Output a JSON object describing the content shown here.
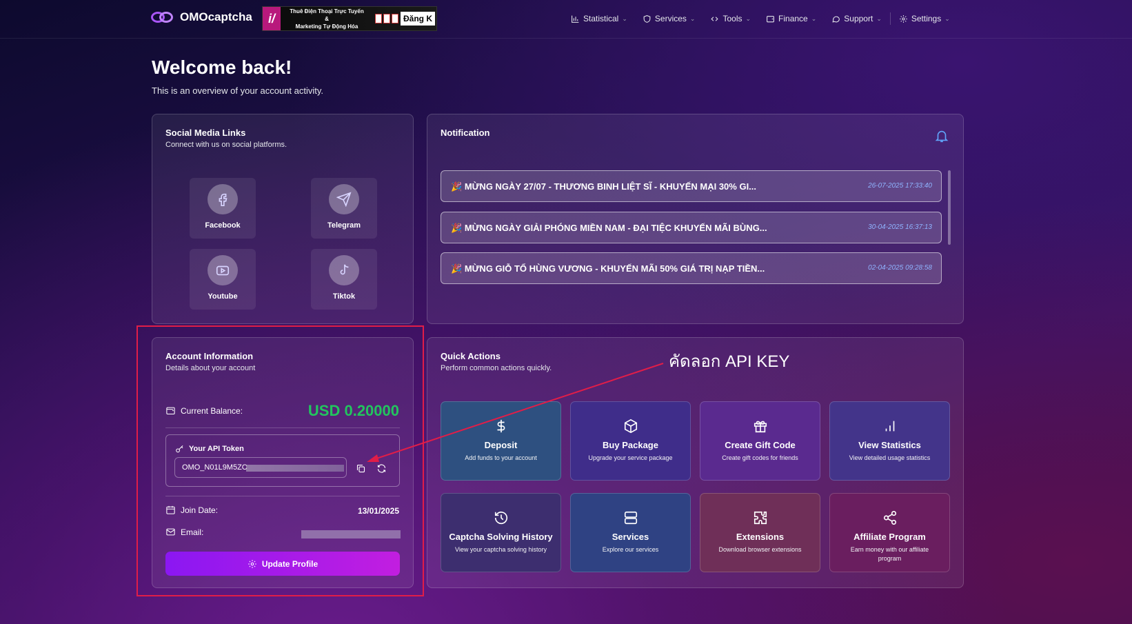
{
  "brand": {
    "name": "OMOcaptcha"
  },
  "banner": {
    "line1": "Thuê Điện Thoại Trực Tuyến",
    "line2": "&",
    "line3": "Marketing Tự Động Hóa",
    "cta": "Đăng K"
  },
  "nav": [
    {
      "label": "Statistical",
      "icon": "bar-chart-icon"
    },
    {
      "label": "Services",
      "icon": "shield-icon"
    },
    {
      "label": "Tools",
      "icon": "code-icon"
    },
    {
      "label": "Finance",
      "icon": "wallet-icon"
    },
    {
      "label": "Support",
      "icon": "chat-icon"
    },
    {
      "label": "Settings",
      "icon": "gear-icon"
    }
  ],
  "page": {
    "title": "Welcome back!",
    "subtitle": "This is an overview of your account activity."
  },
  "social": {
    "title": "Social Media Links",
    "subtitle": "Connect with us on social platforms.",
    "items": [
      {
        "label": "Facebook",
        "icon": "facebook-icon"
      },
      {
        "label": "Telegram",
        "icon": "telegram-icon"
      },
      {
        "label": "Youtube",
        "icon": "youtube-icon"
      },
      {
        "label": "Tiktok",
        "icon": "tiktok-icon"
      }
    ]
  },
  "notification": {
    "title": "Notification",
    "items": [
      {
        "emoji": "🎉",
        "text": "MỪNG NGÀY 27/07 - THƯƠNG BINH LIỆT SĨ - KHUYẾN MẠI 30% GI...",
        "time": "26-07-2025 17:33:40"
      },
      {
        "emoji": "🎉",
        "text": "MỪNG NGÀY GIẢI PHÓNG MIỀN NAM - ĐẠI TIỆC KHUYẾN MÃI BÙNG...",
        "time": "30-04-2025 16:37:13"
      },
      {
        "emoji": "🎉",
        "text": "MỪNG GIỖ TỔ HÙNG VƯƠNG - KHUYẾN MÃI 50% GIÁ TRỊ NẠP TIỀN...",
        "time": "02-04-2025 09:28:58"
      }
    ]
  },
  "account": {
    "title": "Account Information",
    "subtitle": "Details about your account",
    "balance_label": "Current Balance:",
    "balance_value": "USD 0.20000",
    "token_label": "Your API Token",
    "token_value": "OMO_N01L9M5ZC",
    "join_label": "Join Date:",
    "join_value": "13/01/2025",
    "email_label": "Email:",
    "update_label": "Update Profile"
  },
  "quick_actions": {
    "title": "Quick Actions",
    "subtitle": "Perform common actions quickly.",
    "items": [
      {
        "title": "Deposit",
        "desc": "Add funds to your account",
        "color": "#2e5080"
      },
      {
        "title": "Buy Package",
        "desc": "Upgrade your service package",
        "color": "#3f2d8a"
      },
      {
        "title": "Create Gift Code",
        "desc": "Create gift codes for friends",
        "color": "#5a2a8f"
      },
      {
        "title": "View Statistics",
        "desc": "View detailed usage statistics",
        "color": "#43348a"
      },
      {
        "title": "Captcha Solving History",
        "desc": "View your captcha solving history",
        "color": "#3d2e6f"
      },
      {
        "title": "Services",
        "desc": "Explore our services",
        "color": "#2f4283"
      },
      {
        "title": "Extensions",
        "desc": "Download browser extensions",
        "color": "#6f2f58"
      },
      {
        "title": "Affiliate Program",
        "desc": "Earn money with our affiliate program",
        "color": "#6a1e5f"
      }
    ]
  },
  "annotation": {
    "text": "คัดลอก API KEY",
    "color": "#e11d48"
  }
}
